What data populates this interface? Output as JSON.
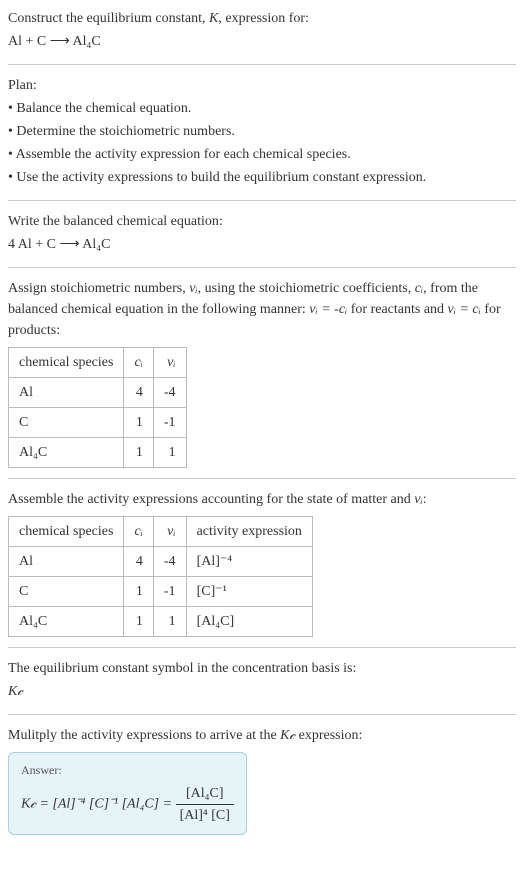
{
  "intro": {
    "line1_pre": "Construct the equilibrium constant, ",
    "line1_k": "K",
    "line1_post": ", expression for:",
    "equation": "Al + C ⟶ Al₄C"
  },
  "plan": {
    "heading": "Plan:",
    "b1": "• Balance the chemical equation.",
    "b2": "• Determine the stoichiometric numbers.",
    "b3": "• Assemble the activity expression for each chemical species.",
    "b4": "• Use the activity expressions to build the equilibrium constant expression."
  },
  "balanced": {
    "heading": "Write the balanced chemical equation:",
    "equation": "4 Al + C ⟶ Al₄C"
  },
  "stoich": {
    "text_pre": "Assign stoichiometric numbers, ",
    "vi": "νᵢ",
    "text_mid1": ", using the stoichiometric coefficients, ",
    "ci": "cᵢ",
    "text_mid2": ", from the balanced chemical equation in the following manner: ",
    "rule1": "νᵢ = -cᵢ",
    "text_mid3": " for reactants and ",
    "rule2": "νᵢ = cᵢ",
    "text_post": " for products:",
    "table": {
      "h1": "chemical species",
      "h2": "cᵢ",
      "h3": "νᵢ",
      "rows": [
        {
          "species": "Al",
          "c": "4",
          "v": "-4"
        },
        {
          "species": "C",
          "c": "1",
          "v": "-1"
        },
        {
          "species": "Al₄C",
          "c": "1",
          "v": "1"
        }
      ]
    }
  },
  "activity": {
    "heading_pre": "Assemble the activity expressions accounting for the state of matter and ",
    "heading_vi": "νᵢ",
    "heading_post": ":",
    "table": {
      "h1": "chemical species",
      "h2": "cᵢ",
      "h3": "νᵢ",
      "h4": "activity expression",
      "rows": [
        {
          "species": "Al",
          "c": "4",
          "v": "-4",
          "expr": "[Al]⁻⁴"
        },
        {
          "species": "C",
          "c": "1",
          "v": "-1",
          "expr": "[C]⁻¹"
        },
        {
          "species": "Al₄C",
          "c": "1",
          "v": "1",
          "expr": "[Al₄C]"
        }
      ]
    }
  },
  "symbol": {
    "line1": "The equilibrium constant symbol in the concentration basis is:",
    "kc": "K𝒸"
  },
  "multiply": {
    "heading_pre": "Mulitply the activity expressions to arrive at the ",
    "kc": "K𝒸",
    "heading_post": " expression:",
    "answer_label": "Answer:",
    "lhs": "K𝒸 = [Al]⁻⁴ [C]⁻¹ [Al₄C] = ",
    "frac_num": "[Al₄C]",
    "frac_den": "[Al]⁴ [C]"
  }
}
